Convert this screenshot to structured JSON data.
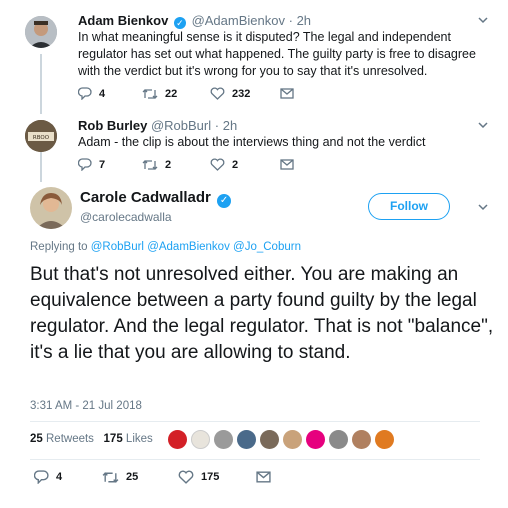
{
  "tweets": [
    {
      "name": "Adam Bienkov",
      "handle": "@AdamBienkov",
      "dot": "·",
      "time": "2h",
      "text": "In what meaningful sense is it disputed? The legal and independent regulator has set out what happened. The guilty party is free to disagree with the verdict but it's wrong for you to say that it's unresolved.",
      "replies": "4",
      "retweets": "22",
      "likes": "232"
    },
    {
      "name": "Rob Burley",
      "handle": "@RobBurl",
      "dot": "·",
      "time": "2h",
      "text": "Adam - the clip is about the interviews thing and not the verdict",
      "replies": "7",
      "retweets": "2",
      "likes": "2"
    }
  ],
  "main": {
    "name": "Carole Cadwalladr",
    "handle": "@carolecadwalla",
    "follow_label": "Follow",
    "replying_prefix": "Replying to",
    "mentions": [
      "@RobBurl",
      "@AdamBienkov",
      "@Jo_Coburn"
    ],
    "text": "But that's not unresolved either. You are making an equivalence between a party found guilty by the legal regulator. And the legal regulator. That is not \"balance\", it's a lie that you are allowing to stand.",
    "timestamp": "3:31 AM - 21 Jul 2018",
    "retweet_count": "25",
    "retweet_label": "Retweets",
    "like_count": "175",
    "like_label": "Likes",
    "replies": "4",
    "retweets": "25",
    "likes": "175"
  },
  "icons": {
    "reply": "reply-icon",
    "retweet": "retweet-icon",
    "like": "heart-icon",
    "dm": "envelope-icon",
    "verified": "verified-badge-icon",
    "chevron": "chevron-down-icon"
  },
  "colors": {
    "accent": "#1da1f2",
    "muted": "#657786",
    "text": "#14171a",
    "line": "#ccd6dd"
  }
}
